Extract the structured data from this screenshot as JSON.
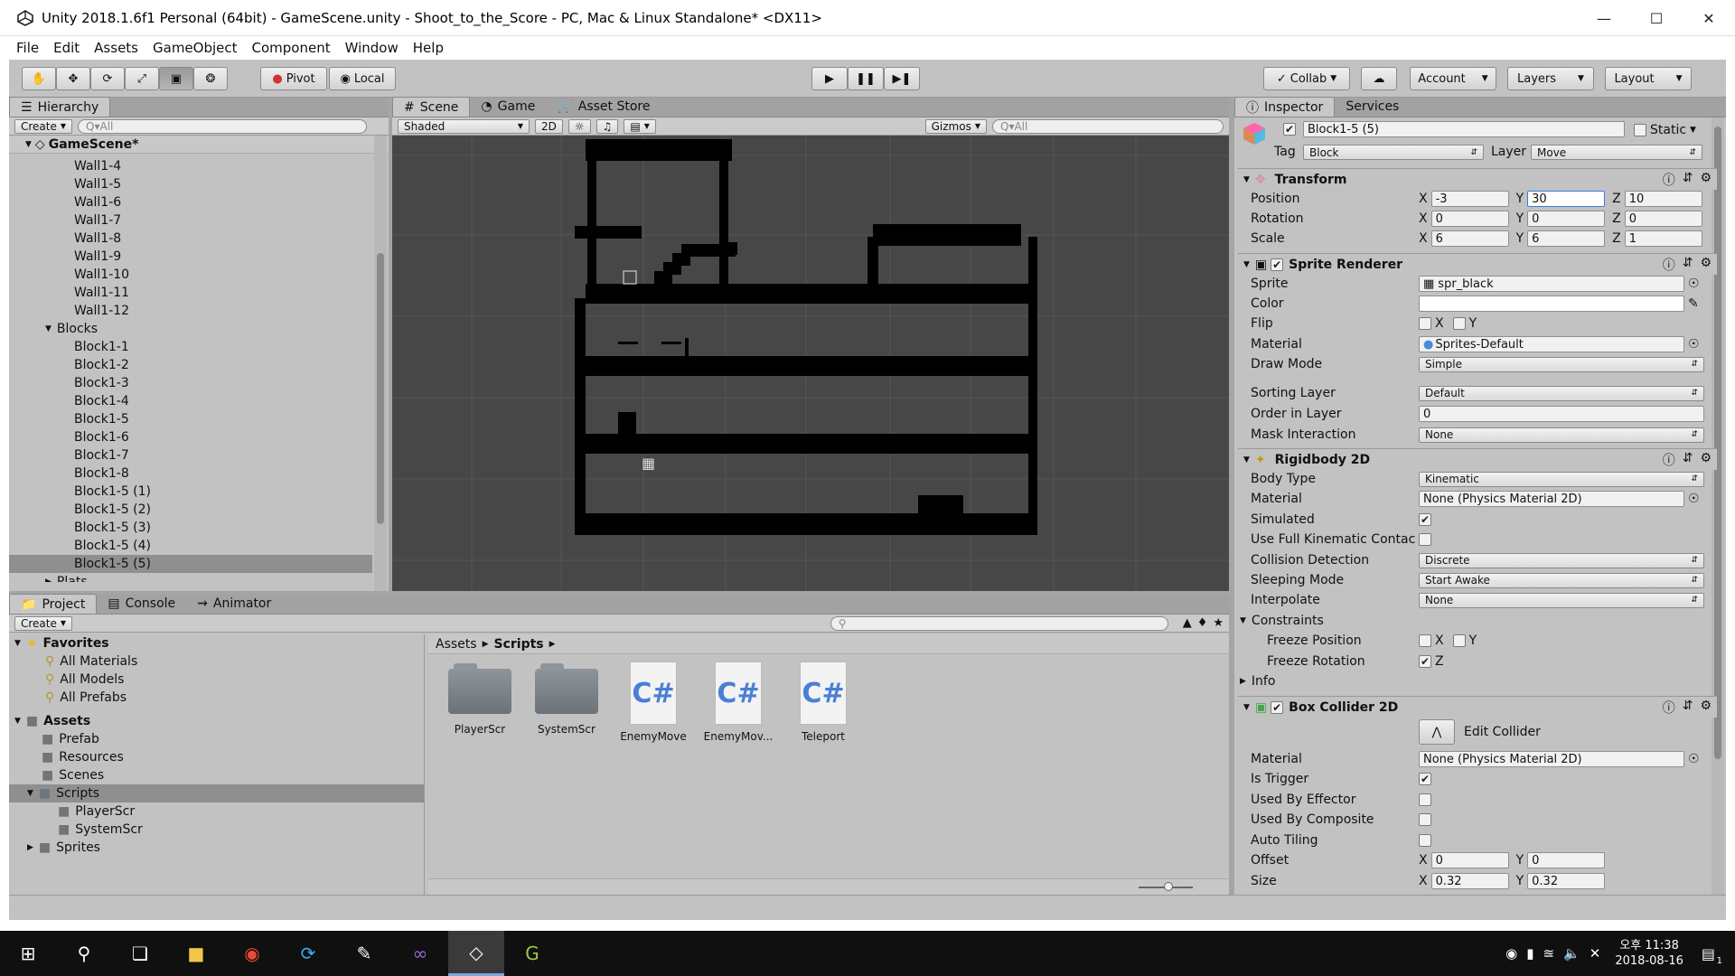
{
  "window": {
    "title": "Unity 2018.1.6f1 Personal (64bit) - GameScene.unity - Shoot_to_the_Score - PC, Mac & Linux Standalone* <DX11>"
  },
  "menu": [
    "File",
    "Edit",
    "Assets",
    "GameObject",
    "Component",
    "Window",
    "Help"
  ],
  "toolbar": {
    "pivot": "Pivot",
    "local": "Local",
    "collab": "Collab",
    "account": "Account",
    "layers": "Layers",
    "layout": "Layout"
  },
  "hierarchy": {
    "tab": "Hierarchy",
    "create": "Create",
    "search_placeholder": "Q▾All",
    "scene": "GameScene*",
    "items": [
      "Wall1-4",
      "Wall1-5",
      "Wall1-6",
      "Wall1-7",
      "Wall1-8",
      "Wall1-9",
      "Wall1-10",
      "Wall1-11",
      "Wall1-12"
    ],
    "blocks_label": "Blocks",
    "blocks": [
      "Block1-1",
      "Block1-2",
      "Block1-3",
      "Block1-4",
      "Block1-5",
      "Block1-6",
      "Block1-7",
      "Block1-8",
      "Block1-5 (1)",
      "Block1-5 (2)",
      "Block1-5 (3)",
      "Block1-5 (4)",
      "Block1-5 (5)"
    ],
    "plats_label": "Plats"
  },
  "scene": {
    "tabs": [
      "Scene",
      "Game",
      "Asset Store"
    ],
    "shading": "Shaded",
    "mode_2d": "2D",
    "gizmos": "Gizmos",
    "search_placeholder": "Q▾All"
  },
  "project": {
    "tabs": [
      "Project",
      "Console",
      "Animator"
    ],
    "create": "Create",
    "favorites_label": "Favorites",
    "favorites": [
      "All Materials",
      "All Models",
      "All Prefabs"
    ],
    "assets_label": "Assets",
    "folders": [
      "Prefab",
      "Resources",
      "Scenes",
      "Scripts"
    ],
    "script_folders": [
      "PlayerScr",
      "SystemScr"
    ],
    "sprites_label": "Sprites",
    "breadcrumb_root": "Assets",
    "breadcrumb_current": "Scripts",
    "files": [
      {
        "name": "PlayerScr",
        "kind": "folder"
      },
      {
        "name": "SystemScr",
        "kind": "folder"
      },
      {
        "name": "EnemyMove",
        "kind": "cs"
      },
      {
        "name": "EnemyMov...",
        "kind": "cs"
      },
      {
        "name": "Teleport",
        "kind": "cs"
      }
    ]
  },
  "inspector": {
    "tabs": [
      "Inspector",
      "Services"
    ],
    "object_name": "Block1-5 (5)",
    "static_label": "Static",
    "tag_label": "Tag",
    "tag_value": "Block",
    "layer_label": "Layer",
    "layer_value": "Move",
    "transform": {
      "title": "Transform",
      "position_label": "Position",
      "pos_x": "-3",
      "pos_y": "30",
      "pos_z": "10",
      "rotation_label": "Rotation",
      "rot_x": "0",
      "rot_y": "0",
      "rot_z": "0",
      "scale_label": "Scale",
      "scl_x": "6",
      "scl_y": "6",
      "scl_z": "1"
    },
    "sprite_renderer": {
      "title": "Sprite Renderer",
      "sprite_label": "Sprite",
      "sprite_value": "spr_black",
      "color_label": "Color",
      "flip_label": "Flip",
      "material_label": "Material",
      "material_value": "Sprites-Default",
      "draw_mode_label": "Draw Mode",
      "draw_mode_value": "Simple",
      "sorting_layer_label": "Sorting Layer",
      "sorting_layer_value": "Default",
      "order_label": "Order in Layer",
      "order_value": "0",
      "mask_label": "Mask Interaction",
      "mask_value": "None"
    },
    "rigidbody": {
      "title": "Rigidbody 2D",
      "body_type_label": "Body Type",
      "body_type_value": "Kinematic",
      "material_label": "Material",
      "material_value": "None (Physics Material 2D)",
      "simulated_label": "Simulated",
      "full_kinematic_label": "Use Full Kinematic Contac",
      "collision_label": "Collision Detection",
      "collision_value": "Discrete",
      "sleeping_label": "Sleeping Mode",
      "sleeping_value": "Start Awake",
      "interpolate_label": "Interpolate",
      "interpolate_value": "None",
      "constraints_label": "Constraints",
      "freeze_pos_label": "Freeze Position",
      "freeze_rot_label": "Freeze Rotation",
      "info_label": "Info"
    },
    "box_collider": {
      "title": "Box Collider 2D",
      "edit_label": "Edit Collider",
      "material_label": "Material",
      "material_value": "None (Physics Material 2D)",
      "trigger_label": "Is Trigger",
      "effector_label": "Used By Effector",
      "composite_label": "Used By Composite",
      "tiling_label": "Auto Tiling",
      "offset_label": "Offset",
      "off_x": "0",
      "off_y": "0",
      "size_label": "Size",
      "size_x": "0.32",
      "size_y": "0.32"
    }
  },
  "axes": {
    "x": "X",
    "y": "Y",
    "z": "Z"
  },
  "taskbar": {
    "time": "오후 11:38",
    "date": "2018-08-16",
    "notifications": "1"
  }
}
